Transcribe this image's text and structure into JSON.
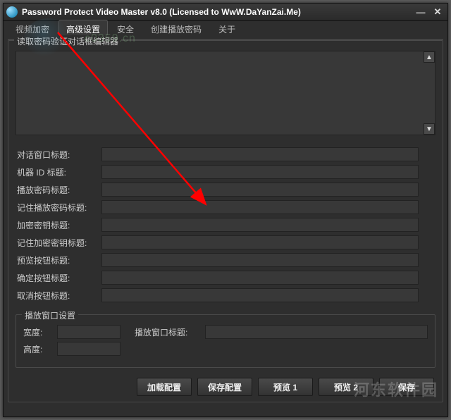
{
  "window": {
    "title": "Password Protect Video Master v8.0 (Licensed to WwW.DaYanZai.Me)"
  },
  "tabs": {
    "items": [
      {
        "label": "视频加密"
      },
      {
        "label": "高级设置"
      },
      {
        "label": "安全"
      },
      {
        "label": "创建播放密码"
      },
      {
        "label": "关于"
      }
    ],
    "active_index": 1
  },
  "editor_group": {
    "title": "读取密码验证对话框编辑器",
    "text": ""
  },
  "fields": [
    {
      "label": "对话窗口标题:",
      "value": ""
    },
    {
      "label": "机器 ID 标题:",
      "value": ""
    },
    {
      "label": "播放密码标题:",
      "value": ""
    },
    {
      "label": "记住播放密码标题:",
      "value": ""
    },
    {
      "label": "加密密钥标题:",
      "value": ""
    },
    {
      "label": "记住加密密钥标题:",
      "value": ""
    },
    {
      "label": "预览按钮标题:",
      "value": ""
    },
    {
      "label": "确定按钮标题:",
      "value": ""
    },
    {
      "label": "取消按钮标题:",
      "value": ""
    }
  ],
  "play_window": {
    "title": "播放窗口设置",
    "width_label": "宽度:",
    "width_value": "",
    "height_label": "高度:",
    "height_value": "",
    "pwtitle_label": "播放窗口标题:",
    "pwtitle_value": ""
  },
  "buttons": {
    "load": "加载配置",
    "save_cfg": "保存配置",
    "preview1": "预览 1",
    "preview2": "预览 2",
    "save": "保存"
  },
  "watermark": {
    "url": "c0359.cn",
    "site": "河东软件园"
  }
}
